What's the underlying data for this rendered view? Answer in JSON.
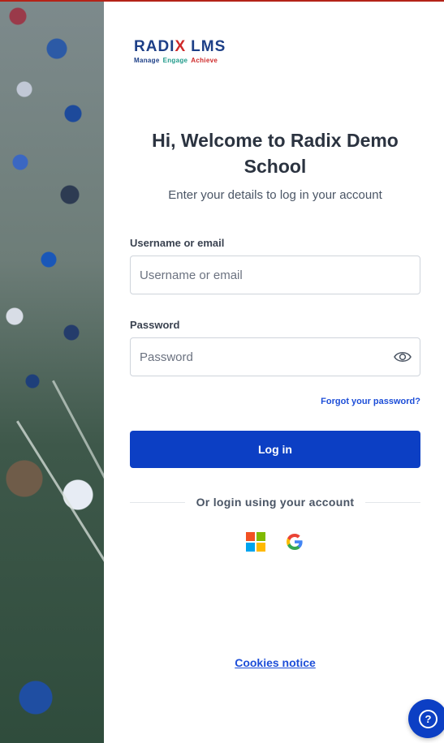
{
  "brand": {
    "logo_word": "RADIX",
    "logo_suffix": "LMS",
    "tag_manage": "Manage",
    "tag_engage": "Engage",
    "tag_achieve": "Achieve"
  },
  "heading": {
    "title": "Hi, Welcome to Radix Demo School",
    "subtitle": "Enter your details to log in your account"
  },
  "form": {
    "username_label": "Username or email",
    "username_placeholder": "Username or email",
    "password_label": "Password",
    "password_placeholder": "Password",
    "forgot_link": "Forgot your password?",
    "login_button": "Log in"
  },
  "alt_login": {
    "divider_text": "Or login using your account",
    "providers": [
      "microsoft-icon",
      "google-icon"
    ]
  },
  "footer": {
    "cookies_link": "Cookies notice"
  },
  "help": {
    "icon": "help-icon",
    "glyph": "?"
  },
  "colors": {
    "accent": "#0c3fc4",
    "link": "#1d4ed8",
    "top_bar": "#b42318",
    "logo_blue": "#1d3f87",
    "logo_red": "#cf2a2a",
    "logo_teal": "#1f9a8a"
  }
}
